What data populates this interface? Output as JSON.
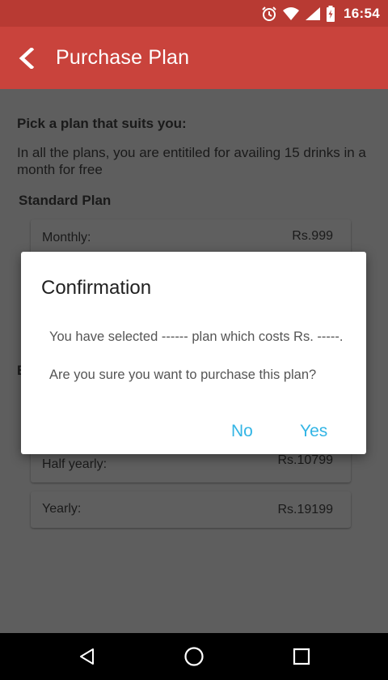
{
  "status_bar": {
    "time": "16:54",
    "icons": [
      "alarm-icon",
      "wifi-icon",
      "signal-icon",
      "battery-icon"
    ],
    "color": "#b83a33"
  },
  "app_bar": {
    "title": "Purchase Plan",
    "back_icon": "back-arrow-icon",
    "color": "#c9433c"
  },
  "content": {
    "heading": "Pick a plan that suits you:",
    "description": "In all the plans, you are entitiled for availing 15 drinks in a month for free",
    "standard_plan": {
      "title": "Standard Plan",
      "items": [
        {
          "label": "Monthly:",
          "price": "Rs.999"
        }
      ]
    },
    "second_plan": {
      "title_visible": "B",
      "items": [
        {
          "label": "Half yearly:",
          "price": "Rs.10799"
        },
        {
          "label": "Yearly:",
          "price": "Rs.19199"
        }
      ]
    }
  },
  "dialog": {
    "title": "Confirmation",
    "message_line1": "You have selected ------ plan which costs Rs. -----.",
    "message_line2": "Are you sure you want to purchase this plan?",
    "negative_button": "No",
    "positive_button": "Yes",
    "button_color": "#33b5e5"
  },
  "nav_bar": {
    "buttons": [
      "back-triangle-icon",
      "home-circle-icon",
      "recents-square-icon"
    ]
  }
}
